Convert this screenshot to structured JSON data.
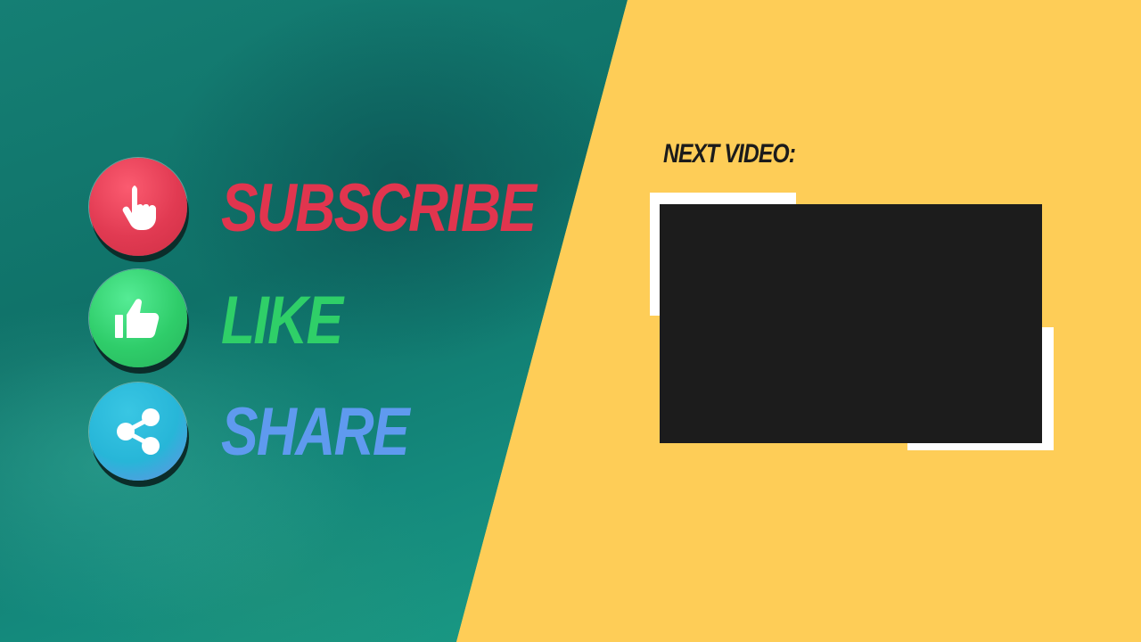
{
  "actions": {
    "subscribe": {
      "label": "SUBSCRIBE",
      "icon": "pointing-hand-icon",
      "color": "#e1354e"
    },
    "like": {
      "label": "LIKE",
      "icon": "thumbs-up-icon",
      "color": "#2fcf68"
    },
    "share": {
      "label": "SHARE",
      "icon": "share-icon",
      "color": "#5f9aef"
    }
  },
  "next_video": {
    "title": "NEXT VIDEO:"
  },
  "colors": {
    "panel": "#fecd57",
    "water": "#137a6c",
    "video_placeholder": "#1c1c1c",
    "frame": "#ffffff"
  }
}
